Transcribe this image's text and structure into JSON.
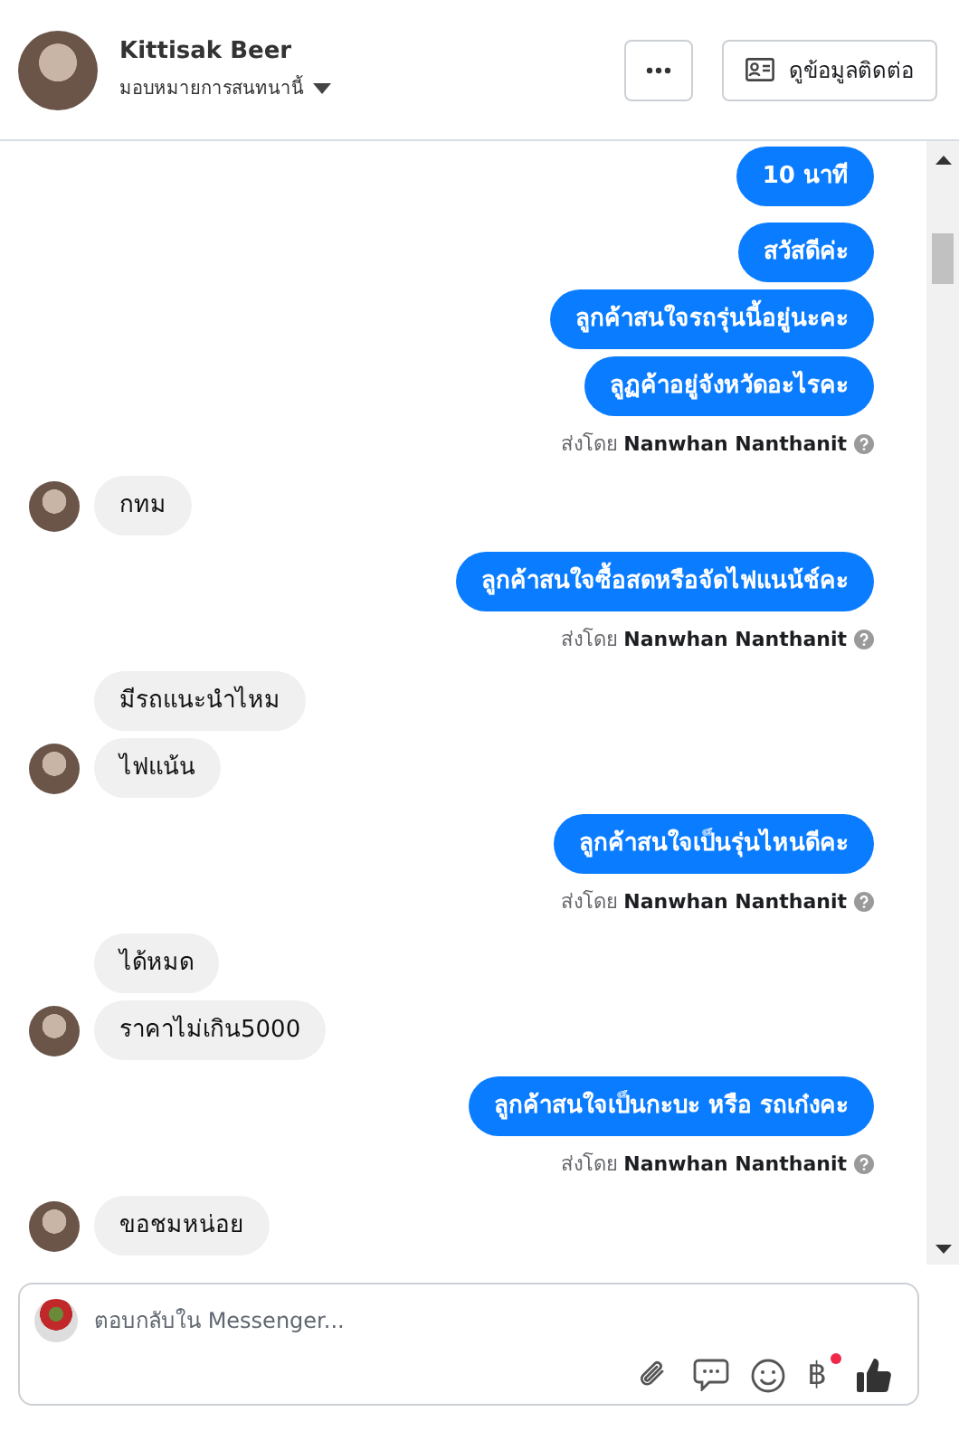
{
  "header": {
    "name": "Kittisak Beer",
    "assign_label": "มอบหมายการสนทนานี้",
    "contact_button": "ดูข้อมูลติดต่อ"
  },
  "groups": [
    {
      "kind": "sent",
      "texts": [
        "10 นาที"
      ]
    },
    {
      "kind": "sent",
      "texts": [
        "สวัสดีค่ะ",
        "ลูกค้าสนใจรถรุ่นนี้อยู่นะคะ",
        "ลูฏค้าอยู่จังหวัดอะไรคะ"
      ],
      "sender": "ส่งโดย **Nanwhan Nanthanit**"
    },
    {
      "kind": "received",
      "texts": [
        "กทม"
      ]
    },
    {
      "kind": "sent",
      "texts": [
        "ลูกค้าสนใจซื้อสดหรือจัดไฟแนน้ช์คะ"
      ],
      "sender": "ส่งโดย **Nanwhan Nanthanit**"
    },
    {
      "kind": "received",
      "texts": [
        "มีรถแนะนำไหม",
        "ไฟแน้น"
      ]
    },
    {
      "kind": "sent",
      "texts": [
        "ลูกค้าสนใจเป็นรุ่นไหนดีคะ"
      ],
      "sender": "ส่งโดย **Nanwhan Nanthanit**"
    },
    {
      "kind": "received",
      "texts": [
        "ได้หมด",
        "ราคาไม่เกิน5000"
      ]
    },
    {
      "kind": "sent",
      "texts": [
        "ลูกค้าสนใจเป็นกะบะ หรือ รถเก๋งคะ"
      ],
      "sender": "ส่งโดย **Nanwhan Nanthanit**"
    },
    {
      "kind": "received",
      "texts": [
        "ขอชมหน่อย"
      ]
    }
  ],
  "composer": {
    "placeholder": "ตอบกลับใน Messenger...",
    "currency_symbol": "฿",
    "currency_alert": true
  }
}
